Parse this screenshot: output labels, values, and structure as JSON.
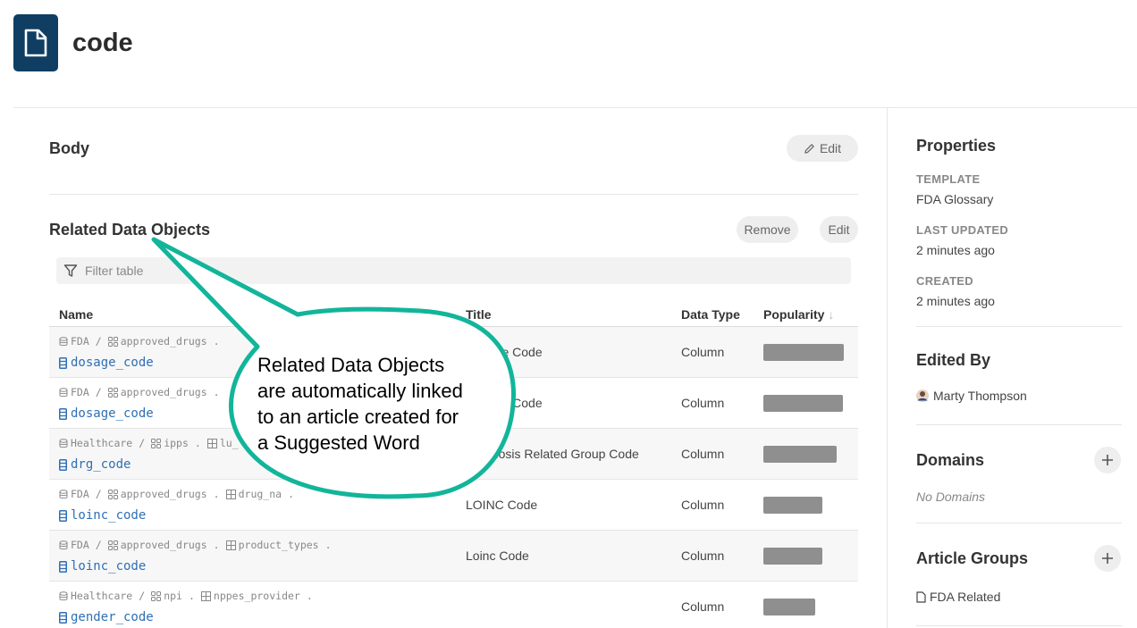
{
  "page": {
    "title": "code"
  },
  "body_section": {
    "title": "Body",
    "edit_label": "Edit"
  },
  "related": {
    "title": "Related Data Objects",
    "remove_label": "Remove",
    "edit_label": "Edit",
    "filter_placeholder": "Filter table",
    "columns": {
      "name": "Name",
      "title": "Title",
      "data_type": "Data Type",
      "popularity": "Popularity"
    },
    "rows": [
      {
        "source": "FDA",
        "schema": "approved_drugs",
        "table": "",
        "name": "dosage_code",
        "title": "Dosage Code",
        "data_type": "Column",
        "popularity": 0.9
      },
      {
        "source": "FDA",
        "schema": "approved_drugs",
        "table": "",
        "name": "dosage_code",
        "title": "Dosage Code",
        "data_type": "Column",
        "popularity": 0.89
      },
      {
        "source": "Healthcare",
        "schema": "ipps",
        "table": "lu_",
        "name": "drg_code",
        "title": "Diagnosis Related Group Code",
        "data_type": "Column",
        "popularity": 0.82
      },
      {
        "source": "FDA",
        "schema": "approved_drugs",
        "table": "drug_na",
        "name": "loinc_code",
        "title": "LOINC Code",
        "data_type": "Column",
        "popularity": 0.66
      },
      {
        "source": "FDA",
        "schema": "approved_drugs",
        "table": "product_types",
        "name": "loinc_code",
        "title": "Loinc Code",
        "data_type": "Column",
        "popularity": 0.66
      },
      {
        "source": "Healthcare",
        "schema": "npi",
        "table": "nppes_provider",
        "name": "gender_code",
        "title": "",
        "data_type": "Column",
        "popularity": 0.58
      }
    ]
  },
  "callout": {
    "lines": [
      "Related Data Objects",
      "are automatically linked",
      "to an article created for",
      "a Suggested Word"
    ],
    "border_color": "#12b59a"
  },
  "sidebar": {
    "properties_title": "Properties",
    "template_label": "TEMPLATE",
    "template_value": "FDA Glossary",
    "last_updated_label": "LAST UPDATED",
    "last_updated_value": "2 minutes ago",
    "created_label": "CREATED",
    "created_value": "2 minutes ago",
    "edited_by_title": "Edited By",
    "editor_name": "Marty Thompson",
    "domains_title": "Domains",
    "domains_empty": "No Domains",
    "article_groups_title": "Article Groups",
    "article_group": "FDA Related"
  },
  "colors": {
    "brand": "#0f3e62",
    "link": "#2f6fb5",
    "popularity_bar": "#8f8f8f"
  }
}
